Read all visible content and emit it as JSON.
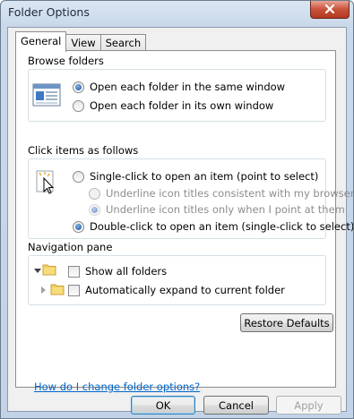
{
  "window": {
    "title": "Folder Options"
  },
  "tabs": [
    {
      "label": "General",
      "active": true
    },
    {
      "label": "View",
      "active": false
    },
    {
      "label": "Search",
      "active": false
    }
  ],
  "browse_folders": {
    "label": "Browse folders",
    "options": [
      {
        "label": "Open each folder in the same window",
        "selected": true
      },
      {
        "label": "Open each folder in its own window",
        "selected": false
      }
    ]
  },
  "click_items": {
    "label": "Click items as follows",
    "options": {
      "single": {
        "label": "Single-click to open an item (point to select)",
        "selected": false
      },
      "underline_consistent": {
        "label": "Underline icon titles consistent with my browser",
        "selected": false,
        "enabled": false
      },
      "underline_point": {
        "label": "Underline icon titles only when I point at them",
        "selected": true,
        "enabled": false
      },
      "double": {
        "label": "Double-click to open an item (single-click to select)",
        "selected": true
      }
    }
  },
  "navigation_pane": {
    "label": "Navigation pane",
    "show_all_folders": {
      "label": "Show all folders",
      "checked": false
    },
    "auto_expand": {
      "label": "Automatically expand to current folder",
      "checked": false
    }
  },
  "buttons": {
    "restore_defaults": "Restore Defaults",
    "ok": "OK",
    "cancel": "Cancel",
    "apply": "Apply"
  },
  "help_link": "How do I change folder options?",
  "colors": {
    "link": "#0066cc",
    "close_button": "#c9523a",
    "selection": "#1b4f9a"
  },
  "icons": {
    "close": "close-icon",
    "browse": "folder-window-icon",
    "click": "pointer-icon",
    "nav_expanded": "triangle-down-icon",
    "nav_collapsed": "triangle-right-icon",
    "folder": "folder-icon"
  }
}
